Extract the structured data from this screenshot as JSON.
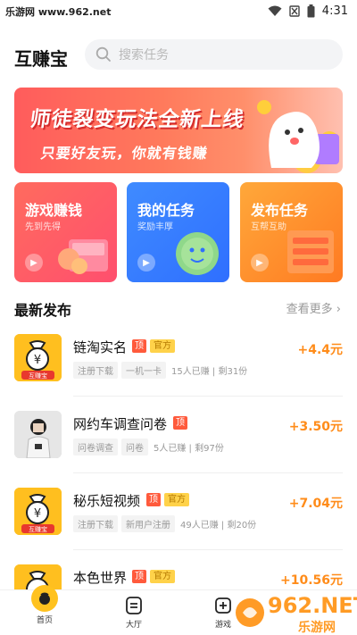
{
  "status_bar": {
    "site": "乐游网 www.962.net",
    "time": "4:31"
  },
  "header": {
    "title": "互赚宝",
    "search_placeholder": "搜索任务"
  },
  "banner": {
    "title": "师徒裂变玩法全新上线",
    "subtitle": "只要好友玩，你就有钱赚"
  },
  "cards": [
    {
      "title": "游戏赚钱",
      "subtitle": "先到先得"
    },
    {
      "title": "我的任务",
      "subtitle": "奖励丰厚"
    },
    {
      "title": "发布任务",
      "subtitle": "互帮互助"
    }
  ],
  "section": {
    "title": "最新发布",
    "more": "查看更多"
  },
  "thumb_label": "互赚宝",
  "tasks": [
    {
      "name": "链淘实名",
      "ding": "顶",
      "official": "官方",
      "chips": [
        "注册下载",
        "一机一卡"
      ],
      "stats": "15人已赚 | 剩31份",
      "reward": "+4.4元"
    },
    {
      "name": "网约车调查问卷",
      "ding": "顶",
      "official": "",
      "chips": [
        "问卷调查",
        "问卷"
      ],
      "stats": "5人已赚 | 剩97份",
      "reward": "+3.50元"
    },
    {
      "name": "秘乐短视频",
      "ding": "顶",
      "official": "官方",
      "chips": [
        "注册下载",
        "新用户注册"
      ],
      "stats": "49人已赚 | 剩20份",
      "reward": "+7.04元"
    },
    {
      "name": "本色世界",
      "ding": "顶",
      "official": "官方",
      "chips": [],
      "stats": "",
      "reward": "+10.56元"
    }
  ],
  "bottom_nav": [
    {
      "label": "首页"
    },
    {
      "label": "大厅"
    },
    {
      "label": "游戏"
    }
  ],
  "watermark": {
    "top": "962.NET",
    "bottom": "乐游网"
  },
  "colors": {
    "brand_yellow": "#ffc21f",
    "reward_orange": "#ff8c1a",
    "ding_red": "#ff5a3c",
    "card_red": "#ff5a66",
    "card_blue": "#3a7fff",
    "card_orange": "#ff8f2a"
  }
}
